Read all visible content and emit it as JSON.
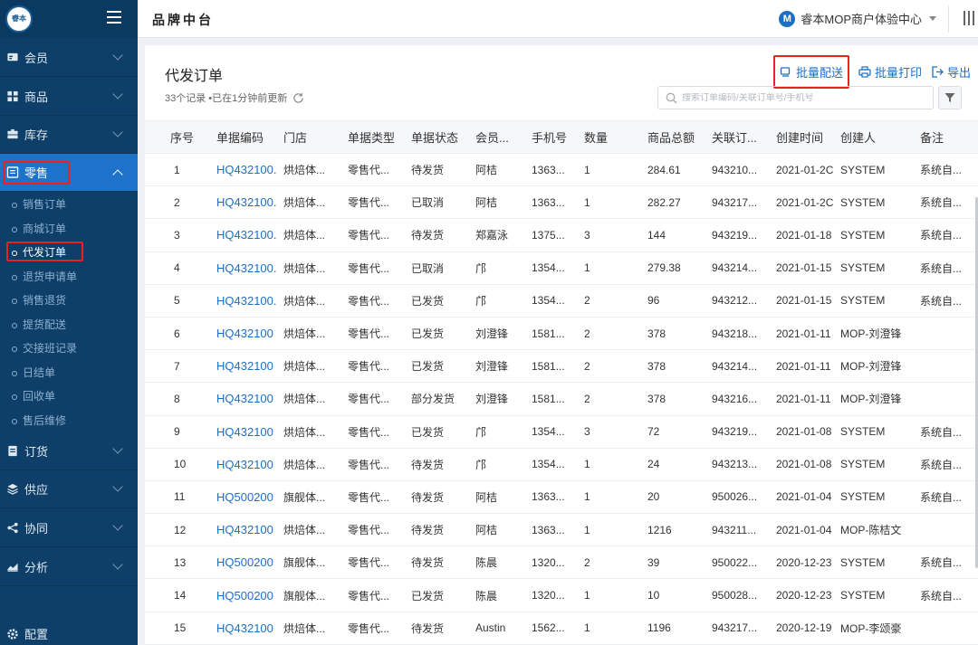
{
  "app": {
    "brand": "品牌中台",
    "logo_text": "睿本",
    "merchant_initial": "M",
    "merchant_name": "睿本MOP商户体验中心"
  },
  "sidebar": {
    "items": [
      {
        "label": "会员",
        "icon": "member-card-icon"
      },
      {
        "label": "商品",
        "icon": "grid-icon"
      },
      {
        "label": "库存",
        "icon": "inventory-icon"
      },
      {
        "label": "零售",
        "icon": "retail-icon"
      },
      {
        "label": "订货",
        "icon": "order-icon"
      },
      {
        "label": "供应",
        "icon": "layers-icon"
      },
      {
        "label": "协同",
        "icon": "share-icon"
      },
      {
        "label": "分析",
        "icon": "chart-icon"
      }
    ],
    "retail_sub": [
      "销售订单",
      "商城订单",
      "代发订单",
      "退货申请单",
      "销售退货",
      "提货配送",
      "交接班记录",
      "日结单",
      "回收单",
      "售后维修"
    ],
    "config_label": "配置"
  },
  "page": {
    "title": "代发订单",
    "record_info": "33个记录 •已在1分钟前更新",
    "actions": {
      "batch_delivery": "批量配送",
      "batch_print": "批量打印",
      "export": "导出"
    },
    "search_placeholder": "搜索订单编码/关联订单号/手机号"
  },
  "colors": {
    "sidebar": "#0d3f69",
    "accent": "#1d72c9",
    "link": "#1d6fc4",
    "highlight": "#e52323"
  },
  "table": {
    "headers": [
      "序号",
      "单据编码",
      "门店",
      "单据类型",
      "单据状态",
      "会员...",
      "手机号",
      "数量",
      "商品总额",
      "关联订...",
      "创建时间",
      "创建人",
      "备注"
    ],
    "rows": [
      [
        "1",
        "HQ432100.",
        "烘焙体...",
        "零售代...",
        "待发货",
        "阿桔",
        "1363...",
        "1",
        "284.61",
        "943210...",
        "2021-01-2C",
        "SYSTEM",
        "系统自..."
      ],
      [
        "2",
        "HQ432100.",
        "烘焙体...",
        "零售代...",
        "已取消",
        "阿桔",
        "1363...",
        "1",
        "282.27",
        "943217...",
        "2021-01-2C",
        "SYSTEM",
        "系统自..."
      ],
      [
        "3",
        "HQ432100.",
        "烘焙体...",
        "零售代...",
        "待发货",
        "郑嘉泳",
        "1375...",
        "3",
        "144",
        "943219...",
        "2021-01-18",
        "SYSTEM",
        "系统自..."
      ],
      [
        "4",
        "HQ432100.",
        "烘焙体...",
        "零售代...",
        "已取消",
        "邝",
        "1354...",
        "1",
        "279.38",
        "943214...",
        "2021-01-15",
        "SYSTEM",
        "系统自..."
      ],
      [
        "5",
        "HQ432100.",
        "烘焙体...",
        "零售代...",
        "已发货",
        "邝",
        "1354...",
        "2",
        "96",
        "943212...",
        "2021-01-15",
        "SYSTEM",
        "系统自..."
      ],
      [
        "6",
        "HQ432100",
        "烘焙体...",
        "零售代...",
        "已发货",
        "刘澄锋",
        "1581...",
        "2",
        "378",
        "943218...",
        "2021-01-11",
        "MOP-刘澄锋",
        ""
      ],
      [
        "7",
        "HQ432100",
        "烘焙体...",
        "零售代...",
        "已发货",
        "刘澄锋",
        "1581...",
        "2",
        "378",
        "943214...",
        "2021-01-11",
        "MOP-刘澄锋",
        ""
      ],
      [
        "8",
        "HQ432100",
        "烘焙体...",
        "零售代...",
        "部分发货",
        "刘澄锋",
        "1581...",
        "2",
        "378",
        "943216...",
        "2021-01-11",
        "MOP-刘澄锋",
        ""
      ],
      [
        "9",
        "HQ432100",
        "烘焙体...",
        "零售代...",
        "已发货",
        "邝",
        "1354...",
        "3",
        "72",
        "943219...",
        "2021-01-08",
        "SYSTEM",
        "系统自..."
      ],
      [
        "10",
        "HQ432100",
        "烘焙体...",
        "零售代...",
        "待发货",
        "邝",
        "1354...",
        "1",
        "24",
        "943213...",
        "2021-01-08",
        "SYSTEM",
        "系统自..."
      ],
      [
        "11",
        "HQ500200",
        "旗舰体...",
        "零售代...",
        "待发货",
        "阿桔",
        "1363...",
        "1",
        "20",
        "950026...",
        "2021-01-04",
        "SYSTEM",
        "系统自..."
      ],
      [
        "12",
        "HQ432100",
        "烘焙体...",
        "零售代...",
        "待发货",
        "阿桔",
        "1363...",
        "1",
        "1216",
        "943211...",
        "2021-01-04",
        "MOP-陈桔文",
        ""
      ],
      [
        "13",
        "HQ500200",
        "旗舰体...",
        "零售代...",
        "待发货",
        "陈晨",
        "1320...",
        "2",
        "39",
        "950022...",
        "2020-12-23",
        "SYSTEM",
        "系统自..."
      ],
      [
        "14",
        "HQ500200",
        "旗舰体...",
        "零售代...",
        "已发货",
        "陈晨",
        "1320...",
        "1",
        "10",
        "950028...",
        "2020-12-23",
        "SYSTEM",
        "系统自..."
      ],
      [
        "15",
        "HQ432100",
        "烘焙体...",
        "零售代...",
        "待发货",
        "Austin",
        "1562...",
        "1",
        "1196",
        "943217...",
        "2020-12-19",
        "MOP-李颂豪",
        ""
      ]
    ]
  }
}
